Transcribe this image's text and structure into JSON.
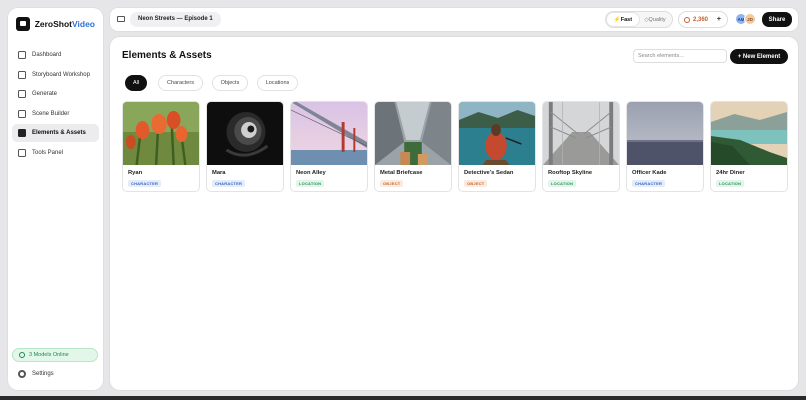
{
  "brand": {
    "name_main": "ZeroShot",
    "name_accent": "Video"
  },
  "sidebar": {
    "items": [
      {
        "label": "Dashboard",
        "active": false,
        "icon": "grid-icon"
      },
      {
        "label": "Storyboard Workshop",
        "active": false,
        "icon": "image-icon"
      },
      {
        "label": "Generate",
        "active": false,
        "icon": "sparkle-icon"
      },
      {
        "label": "Scene Builder",
        "active": false,
        "icon": "layers-icon"
      },
      {
        "label": "Elements & Assets",
        "active": true,
        "icon": "users-icon"
      },
      {
        "label": "Tools Panel",
        "active": false,
        "icon": "tools-icon"
      }
    ],
    "status": "3 Models Online",
    "settings_label": "Settings"
  },
  "topbar": {
    "project_name": "Neon Streets — Episode 1",
    "modes": [
      {
        "label": "Fast",
        "active": true
      },
      {
        "label": "Quality",
        "active": false
      }
    ],
    "credits": "2,360",
    "credits_plus": "+",
    "avatars": [
      "AM",
      "JD"
    ],
    "share_label": "Share"
  },
  "main": {
    "title": "Elements & Assets",
    "search_placeholder": "Search elements...",
    "new_button_label": "+ New Element",
    "filters": [
      {
        "label": "All",
        "active": true
      },
      {
        "label": "Characters",
        "active": false
      },
      {
        "label": "Objects",
        "active": false
      },
      {
        "label": "Locations",
        "active": false
      }
    ],
    "cards": [
      {
        "name": "Ryan",
        "tag": "CHARACTER",
        "kind": "character"
      },
      {
        "name": "Mara",
        "tag": "CHARACTER",
        "kind": "character"
      },
      {
        "name": "Neon Alley",
        "tag": "LOCATION",
        "kind": "location"
      },
      {
        "name": "Metal Briefcase",
        "tag": "OBJECT",
        "kind": "object"
      },
      {
        "name": "Detective's Sedan",
        "tag": "OBJECT",
        "kind": "object"
      },
      {
        "name": "Rooftop Skyline",
        "tag": "LOCATION",
        "kind": "location"
      },
      {
        "name": "Officer Kade",
        "tag": "CHARACTER",
        "kind": "character"
      },
      {
        "name": "24hr Diner",
        "tag": "LOCATION",
        "kind": "location"
      }
    ]
  },
  "colors": {
    "accent": "#2e6fd8",
    "status_green": "#1f8a4c",
    "credits": "#c4622d"
  }
}
